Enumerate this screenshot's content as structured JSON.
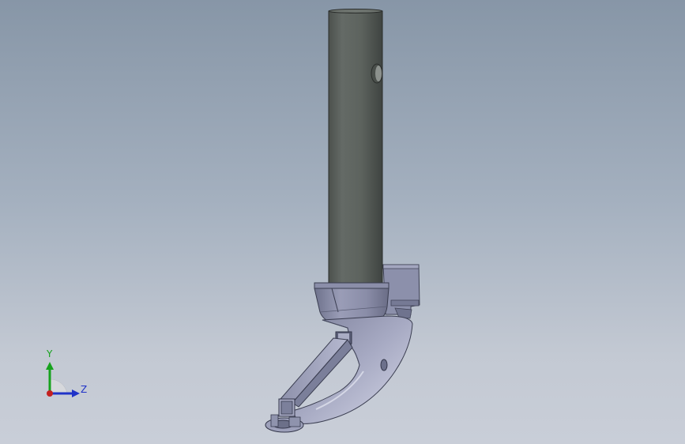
{
  "viewport": {
    "background_top": "#8796a7",
    "background_bottom": "#c9ced8"
  },
  "model": {
    "shaft_color": "#5f6560",
    "body_color": "#8f93ad"
  },
  "triad": {
    "y_label": "Y",
    "z_label": "Z",
    "y_color": "#16a21d",
    "z_color": "#2033c8",
    "x_color": "#c42020"
  }
}
